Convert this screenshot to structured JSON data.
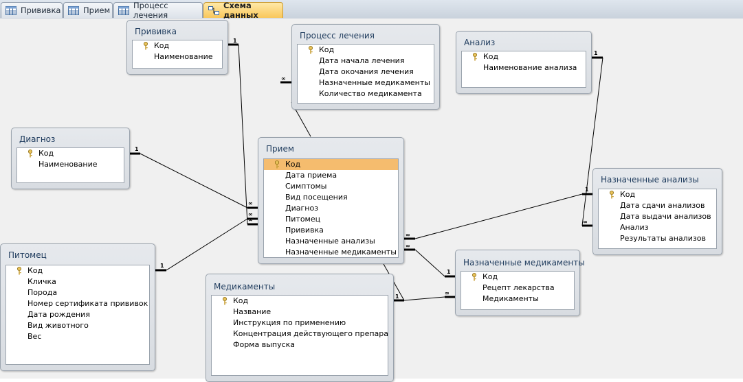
{
  "tabs": [
    {
      "label": "Прививка",
      "icon": "table-icon",
      "active": false
    },
    {
      "label": "Прием",
      "icon": "table-icon",
      "active": false
    },
    {
      "label": "Процесс лечения",
      "icon": "table-icon",
      "active": false
    },
    {
      "label": "Схема данных",
      "icon": "relationships-icon",
      "active": true
    }
  ],
  "tables": {
    "privivka": {
      "title": "Прививка",
      "fields": [
        "Код",
        "Наименование"
      ]
    },
    "process": {
      "title": "Процесс лечения",
      "fields": [
        "Код",
        "Дата начала лечения",
        "Дата окочания лечения",
        "Назначенные медикаменты",
        "Количество медикамента"
      ]
    },
    "analiz": {
      "title": "Анализ",
      "fields": [
        "Код",
        "Наименование анализа"
      ]
    },
    "diagnoz": {
      "title": "Диагноз",
      "fields": [
        "Код",
        "Наименование"
      ]
    },
    "priem": {
      "title": "Прием",
      "fields": [
        "Код",
        "Дата приема",
        "Симптомы",
        "Вид посещения",
        "Диагноз",
        "Питомец",
        "Прививка",
        "Назначенные анализы",
        "Назначенные медикаменты"
      ]
    },
    "nazn_analizy": {
      "title": "Назначенные анализы",
      "fields": [
        "Код",
        "Дата сдачи анализов",
        "Дата выдачи анализов",
        "Анализ",
        "Результаты анализов"
      ]
    },
    "pitomets": {
      "title": "Питомец",
      "fields": [
        "Код",
        "Кличка",
        "Порода",
        "Номер сертификата прививок",
        "Дата рождения",
        "Вид животного",
        "Вес"
      ]
    },
    "medikamenty": {
      "title": "Медикаменты",
      "fields": [
        "Код",
        "Название",
        "Инструкция по применению",
        "Концентрация действующего препарата",
        "Форма выпуска"
      ]
    },
    "nazn_medikamenty": {
      "title": "Назначенные медикаменты",
      "fields": [
        "Код",
        "Рецепт лекарства",
        "Медикаменты"
      ]
    }
  },
  "relation_labels": {
    "one": "1",
    "many": "∞"
  },
  "colors": {
    "selected_row": "#f5bc6e",
    "active_tab": "#f9c75b",
    "canvas": "#f0f0f0",
    "title_text": "#1d3a5c"
  }
}
